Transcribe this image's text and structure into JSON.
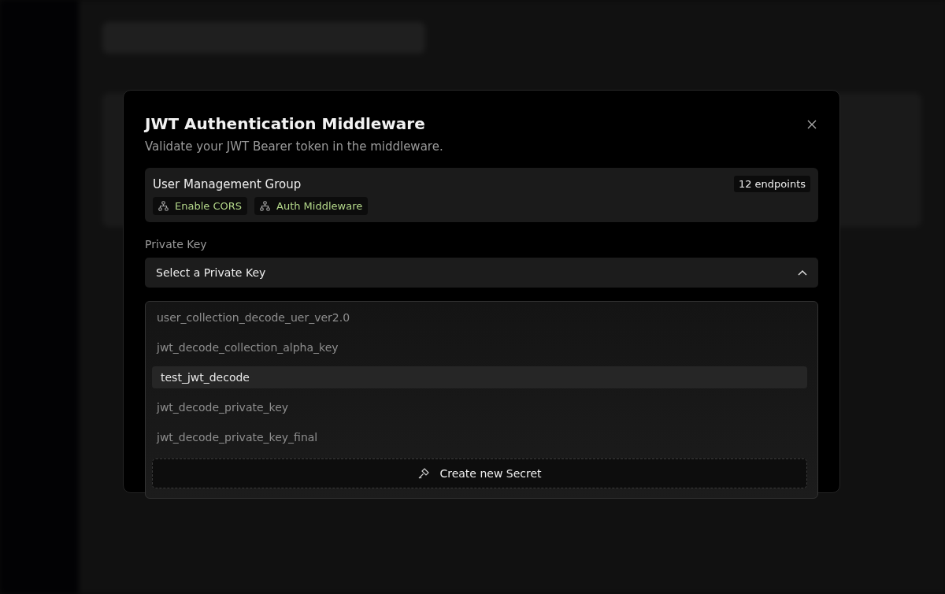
{
  "modal": {
    "title": "JWT Authentication Middleware",
    "subtitle": "Validate your JWT Bearer token in the middleware."
  },
  "group": {
    "name": "User Management Group",
    "count": "12 endpoints",
    "tags": [
      {
        "label": "Enable CORS"
      },
      {
        "label": "Auth Middleware"
      }
    ]
  },
  "private_key": {
    "label": "Private Key",
    "placeholder": "Select a Private Key",
    "expanded": true
  },
  "options": [
    {
      "label": "user_collection_decode_uer_ver2.0",
      "selected": false
    },
    {
      "label": "jwt_decode_collection_alpha_key",
      "selected": false
    },
    {
      "label": "test_jwt_decode",
      "selected": true
    },
    {
      "label": "jwt_decode_private_key",
      "selected": false
    },
    {
      "label": "jwt_decode_private_key_final",
      "selected": false
    }
  ],
  "create_button": {
    "label": "Create new Secret"
  }
}
